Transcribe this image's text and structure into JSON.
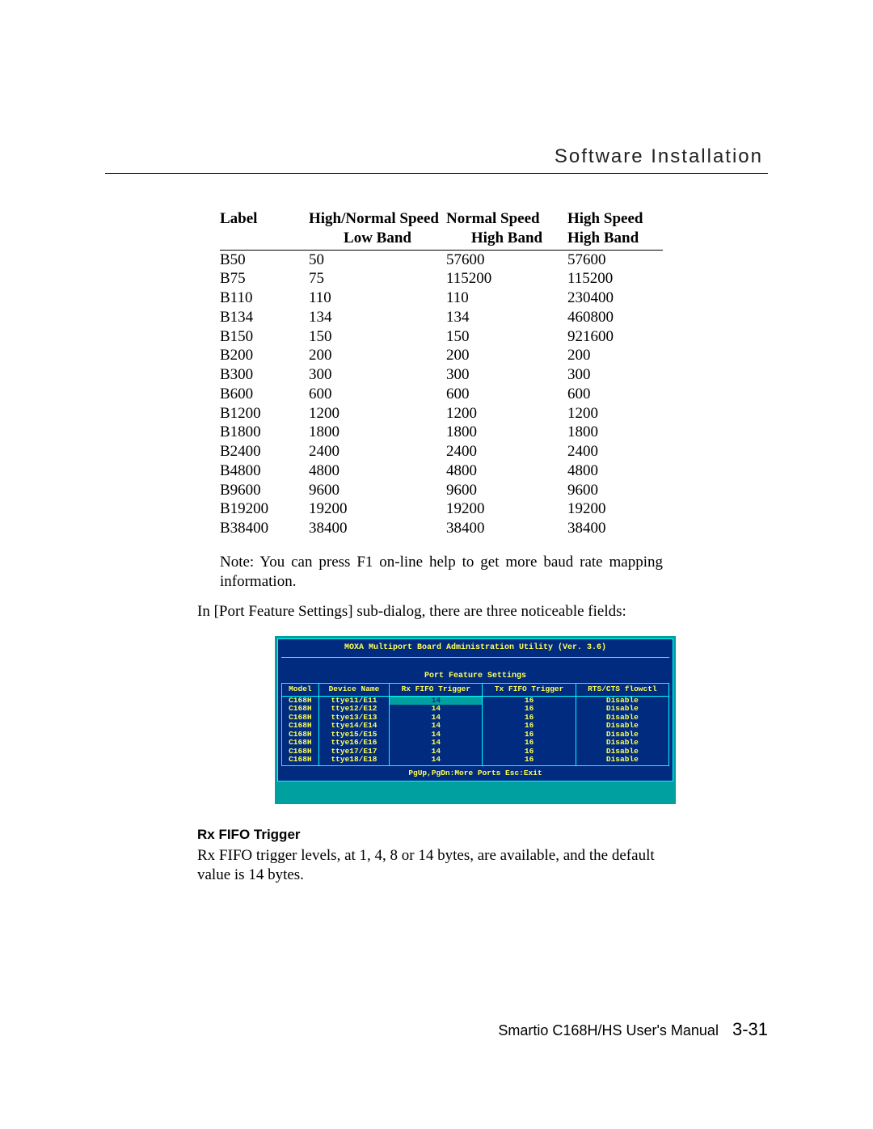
{
  "header": {
    "title": "Software Installation"
  },
  "chart_data": {
    "type": "table",
    "title": "",
    "columns": [
      {
        "group": "Label",
        "sub": ""
      },
      {
        "group": "High/Normal Speed",
        "sub": "Low Band"
      },
      {
        "group": "Normal Speed",
        "sub": "High Band"
      },
      {
        "group": "High Speed",
        "sub": "High Band"
      }
    ],
    "rows": [
      {
        "label": "B50",
        "hn_low": "50",
        "ns_high": "57600",
        "hs_high": "57600"
      },
      {
        "label": "B75",
        "hn_low": "75",
        "ns_high": "115200",
        "hs_high": "115200"
      },
      {
        "label": "B110",
        "hn_low": "110",
        "ns_high": "110",
        "hs_high": "230400"
      },
      {
        "label": "B134",
        "hn_low": "134",
        "ns_high": "134",
        "hs_high": "460800"
      },
      {
        "label": "B150",
        "hn_low": "150",
        "ns_high": "150",
        "hs_high": "921600"
      },
      {
        "label": "B200",
        "hn_low": "200",
        "ns_high": "200",
        "hs_high": "200"
      },
      {
        "label": "B300",
        "hn_low": "300",
        "ns_high": "300",
        "hs_high": "300"
      },
      {
        "label": "B600",
        "hn_low": "600",
        "ns_high": "600",
        "hs_high": "600"
      },
      {
        "label": "B1200",
        "hn_low": "1200",
        "ns_high": "1200",
        "hs_high": "1200"
      },
      {
        "label": "B1800",
        "hn_low": "1800",
        "ns_high": "1800",
        "hs_high": "1800"
      },
      {
        "label": "B2400",
        "hn_low": "2400",
        "ns_high": "2400",
        "hs_high": "2400"
      },
      {
        "label": "B4800",
        "hn_low": "4800",
        "ns_high": "4800",
        "hs_high": "4800"
      },
      {
        "label": "B9600",
        "hn_low": "9600",
        "ns_high": "9600",
        "hs_high": "9600"
      },
      {
        "label": "B19200",
        "hn_low": "19200",
        "ns_high": "19200",
        "hs_high": "19200"
      },
      {
        "label": "B38400",
        "hn_low": "38400",
        "ns_high": "38400",
        "hs_high": "38400"
      }
    ]
  },
  "note_text": "Note: You can press F1 on-line help to get more baud rate mapping information.",
  "subdialog_text": "In [Port Feature Settings] sub-dialog, there are three noticeable fields:",
  "terminal": {
    "title": "MOXA Multiport Board Administration Utility (Ver. 3.6)",
    "subtitle": "Port Feature Settings",
    "headers": [
      "Model",
      "Device Name",
      "Rx FIFO Trigger",
      "Tx FIFO Trigger",
      "RTS/CTS flowctl"
    ],
    "rows": [
      {
        "model": "C168H",
        "dev": "ttye11/E11",
        "rx": "14",
        "tx": "16",
        "flow": "Disable",
        "selected": true
      },
      {
        "model": "C168H",
        "dev": "ttye12/E12",
        "rx": "14",
        "tx": "16",
        "flow": "Disable",
        "selected": false
      },
      {
        "model": "C168H",
        "dev": "ttye13/E13",
        "rx": "14",
        "tx": "16",
        "flow": "Disable",
        "selected": false
      },
      {
        "model": "C168H",
        "dev": "ttye14/E14",
        "rx": "14",
        "tx": "16",
        "flow": "Disable",
        "selected": false
      },
      {
        "model": "C168H",
        "dev": "ttye15/E15",
        "rx": "14",
        "tx": "16",
        "flow": "Disable",
        "selected": false
      },
      {
        "model": "C168H",
        "dev": "ttye16/E16",
        "rx": "14",
        "tx": "16",
        "flow": "Disable",
        "selected": false
      },
      {
        "model": "C168H",
        "dev": "ttye17/E17",
        "rx": "14",
        "tx": "16",
        "flow": "Disable",
        "selected": false
      },
      {
        "model": "C168H",
        "dev": "ttye18/E18",
        "rx": "14",
        "tx": "16",
        "flow": "Disable",
        "selected": false
      }
    ],
    "footer": "PgUp,PgDn:More Ports   Esc:Exit"
  },
  "section": {
    "title": "Rx FIFO Trigger",
    "body": "Rx FIFO trigger levels, at 1, 4, 8 or 14 bytes, are available, and the default value is 14 bytes."
  },
  "footer": {
    "manual": "Smartio C168H/HS User's Manual",
    "page": "3-31"
  }
}
